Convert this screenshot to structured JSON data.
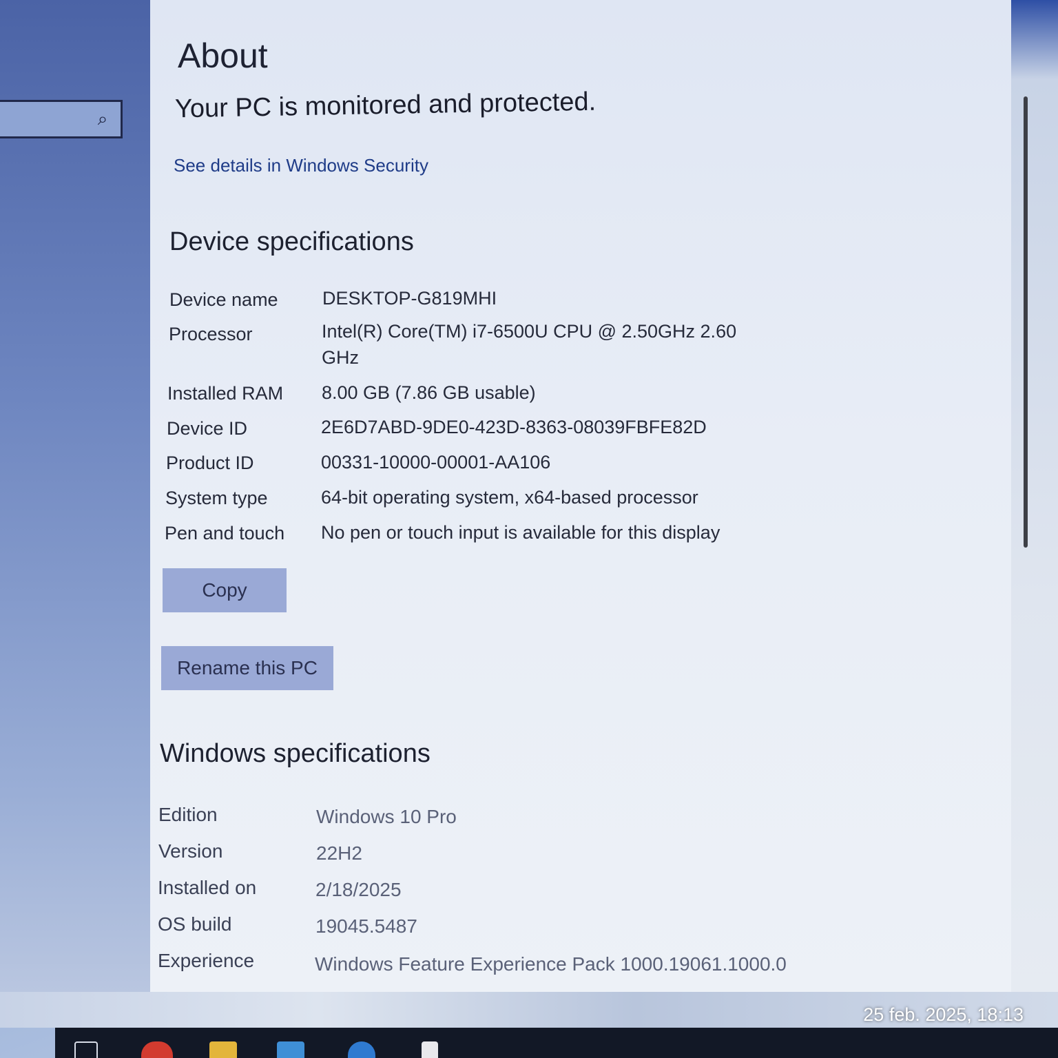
{
  "page": {
    "title": "About"
  },
  "security": {
    "status": "Your PC is monitored and protected.",
    "link": "See details in Windows Security"
  },
  "device_specs": {
    "heading": "Device specifications",
    "rows": [
      {
        "label": "Device name",
        "value": "DESKTOP-G819MHI"
      },
      {
        "label": "Processor",
        "value": "Intel(R) Core(TM) i7-6500U CPU @ 2.50GHz   2.60 GHz"
      },
      {
        "label": "Installed RAM",
        "value": "8.00 GB (7.86 GB usable)"
      },
      {
        "label": "Device ID",
        "value": "2E6D7ABD-9DE0-423D-8363-08039FBFE82D"
      },
      {
        "label": "Product ID",
        "value": "00331-10000-00001-AA106"
      },
      {
        "label": "System type",
        "value": "64-bit operating system, x64-based processor"
      },
      {
        "label": "Pen and touch",
        "value": "No pen or touch input is available for this display"
      }
    ],
    "copy_button": "Copy",
    "rename_button": "Rename this PC"
  },
  "windows_specs": {
    "heading": "Windows specifications",
    "rows": [
      {
        "label": "Edition",
        "value": "Windows 10 Pro"
      },
      {
        "label": "Version",
        "value": "22H2"
      },
      {
        "label": "Installed on",
        "value": "2/18/2025"
      },
      {
        "label": "OS build",
        "value": "19045.5487"
      },
      {
        "label": "Experience",
        "value": "Windows Feature Experience Pack 1000.19061.1000.0"
      }
    ]
  },
  "photo_timestamp": "25 feb. 2025, 18:13",
  "icons": {
    "search": "search-icon"
  }
}
